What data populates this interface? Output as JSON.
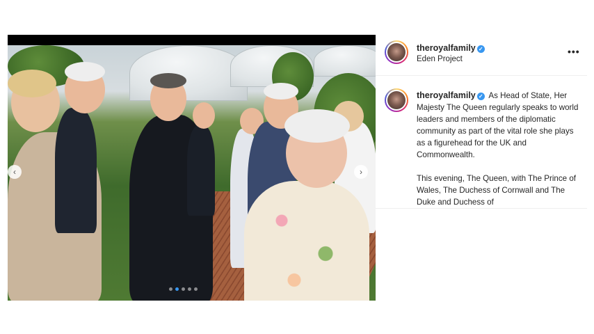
{
  "media": {
    "nav_prev": "‹",
    "nav_next": "›",
    "carousel_count": 5,
    "carousel_active_index": 1
  },
  "post": {
    "username": "theroyalfamily",
    "verified_glyph": "✓",
    "location": "Eden Project",
    "more_glyph": "•••",
    "caption_paragraphs": [
      "As Head of State, Her Majesty The Queen regularly speaks to world leaders and members of the diplomatic community as part of the vital role she plays as a figurehead for the UK and Commonwealth.",
      "This evening, The Queen, with The Prince of Wales, The Duchess of Cornwall and The Duke and Duchess of"
    ]
  },
  "colors": {
    "verified_blue": "#3897f0",
    "text": "#262626",
    "divider": "#efefef"
  },
  "icons": [
    "verified-badge-icon",
    "more-options-icon",
    "chevron-left-icon",
    "chevron-right-icon"
  ]
}
